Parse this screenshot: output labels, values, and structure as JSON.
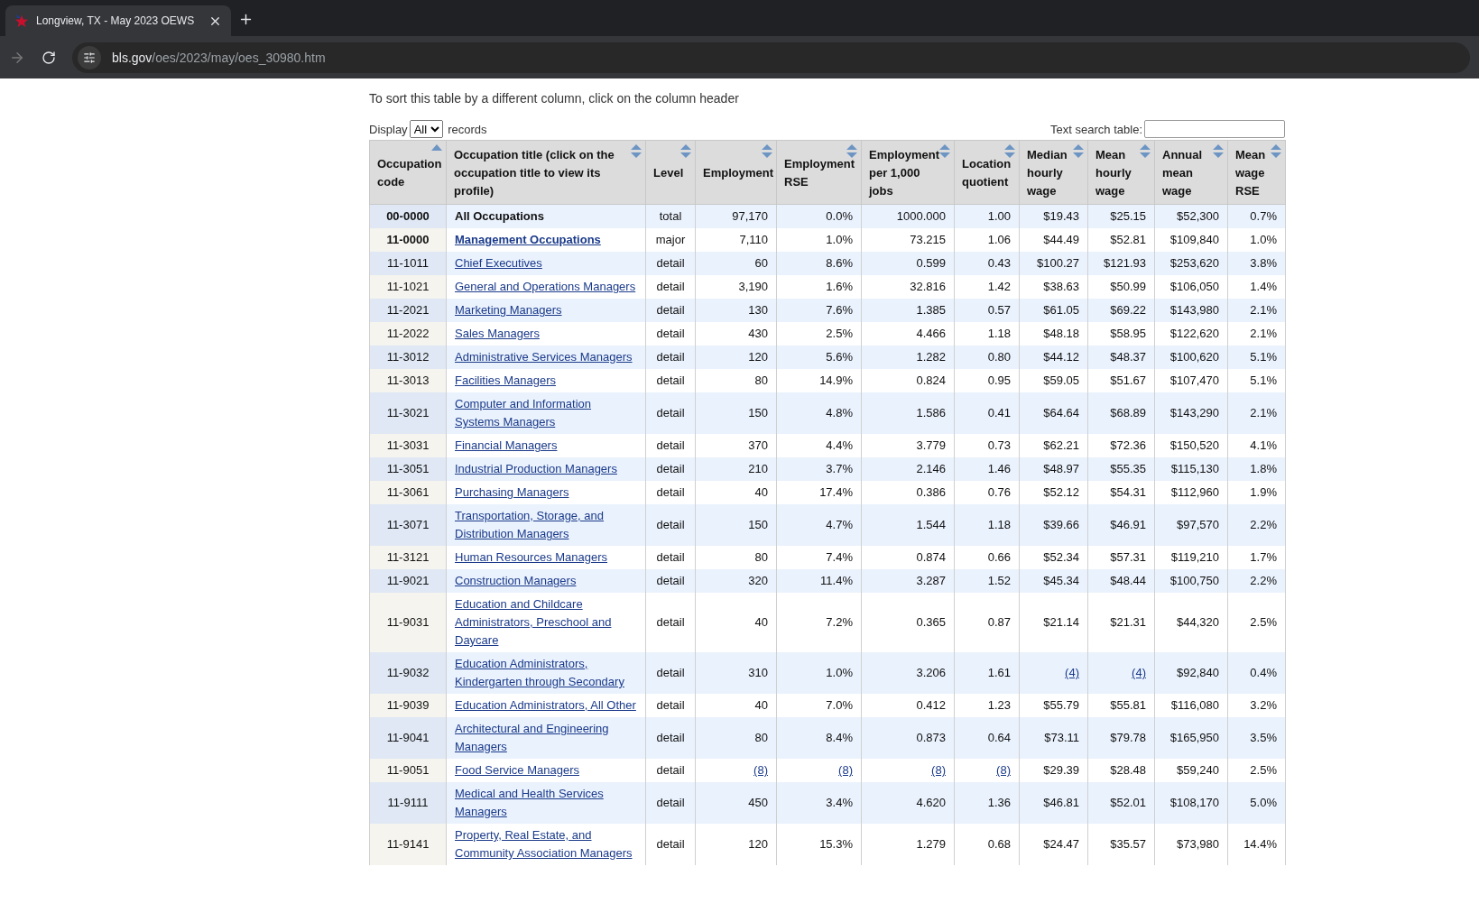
{
  "browser": {
    "tab": {
      "title": "Longview, TX - May 2023 OEWS",
      "selected": true
    },
    "url_host": "bls.gov",
    "url_path": "/oes/2023/may/oes_30980.htm"
  },
  "intro": "To sort this table by a different column, click on the column header",
  "display": {
    "label_before": "Display",
    "value": "All",
    "label_after": "records"
  },
  "search": {
    "label": "Text search table:"
  },
  "table": {
    "columns": [
      {
        "label": "Occupation code",
        "sorted": true
      },
      {
        "label": "Occupation title (click on the occupation title to view its profile)",
        "sorted": false
      },
      {
        "label": "Level",
        "sorted": false
      },
      {
        "label": "Employment",
        "sorted": false
      },
      {
        "label": "Employment RSE",
        "sorted": false
      },
      {
        "label": "Employment per 1,000 jobs",
        "sorted": false
      },
      {
        "label": "Location quotient",
        "sorted": false
      },
      {
        "label": "Median hourly wage",
        "sorted": false
      },
      {
        "label": "Mean hourly wage",
        "sorted": false
      },
      {
        "label": "Annual mean wage",
        "sorted": false
      },
      {
        "label": "Mean wage RSE",
        "sorted": false
      }
    ],
    "rows": [
      {
        "bold": true,
        "title_link": false,
        "cells": [
          "00-0000",
          "All Occupations",
          "total",
          "97,170",
          "0.0%",
          "1000.000",
          "1.00",
          "$19.43",
          "$25.15",
          "$52,300",
          "0.7%"
        ]
      },
      {
        "bold": true,
        "title_link": true,
        "cells": [
          "11-0000",
          "Management Occupations",
          "major",
          "7,110",
          "1.0%",
          "73.215",
          "1.06",
          "$44.49",
          "$52.81",
          "$109,840",
          "1.0%"
        ]
      },
      {
        "bold": false,
        "title_link": true,
        "cells": [
          "11-1011",
          "Chief Executives",
          "detail",
          "60",
          "8.6%",
          "0.599",
          "0.43",
          "$100.27",
          "$121.93",
          "$253,620",
          "3.8%"
        ]
      },
      {
        "bold": false,
        "title_link": true,
        "cells": [
          "11-1021",
          "General and Operations Managers",
          "detail",
          "3,190",
          "1.6%",
          "32.816",
          "1.42",
          "$38.63",
          "$50.99",
          "$106,050",
          "1.4%"
        ]
      },
      {
        "bold": false,
        "title_link": true,
        "cells": [
          "11-2021",
          "Marketing Managers",
          "detail",
          "130",
          "7.6%",
          "1.385",
          "0.57",
          "$61.05",
          "$69.22",
          "$143,980",
          "2.1%"
        ]
      },
      {
        "bold": false,
        "title_link": true,
        "cells": [
          "11-2022",
          "Sales Managers",
          "detail",
          "430",
          "2.5%",
          "4.466",
          "1.18",
          "$48.18",
          "$58.95",
          "$122,620",
          "2.1%"
        ]
      },
      {
        "bold": false,
        "title_link": true,
        "cells": [
          "11-3012",
          "Administrative Services Managers",
          "detail",
          "120",
          "5.6%",
          "1.282",
          "0.80",
          "$44.12",
          "$48.37",
          "$100,620",
          "5.1%"
        ]
      },
      {
        "bold": false,
        "title_link": true,
        "cells": [
          "11-3013",
          "Facilities Managers",
          "detail",
          "80",
          "14.9%",
          "0.824",
          "0.95",
          "$59.05",
          "$51.67",
          "$107,470",
          "5.1%"
        ]
      },
      {
        "bold": false,
        "title_link": true,
        "cells": [
          "11-3021",
          "Computer and Information Systems Managers",
          "detail",
          "150",
          "4.8%",
          "1.586",
          "0.41",
          "$64.64",
          "$68.89",
          "$143,290",
          "2.1%"
        ]
      },
      {
        "bold": false,
        "title_link": true,
        "cells": [
          "11-3031",
          "Financial Managers",
          "detail",
          "370",
          "4.4%",
          "3.779",
          "0.73",
          "$62.21",
          "$72.36",
          "$150,520",
          "4.1%"
        ]
      },
      {
        "bold": false,
        "title_link": true,
        "cells": [
          "11-3051",
          "Industrial Production Managers",
          "detail",
          "210",
          "3.7%",
          "2.146",
          "1.46",
          "$48.97",
          "$55.35",
          "$115,130",
          "1.8%"
        ]
      },
      {
        "bold": false,
        "title_link": true,
        "cells": [
          "11-3061",
          "Purchasing Managers",
          "detail",
          "40",
          "17.4%",
          "0.386",
          "0.76",
          "$52.12",
          "$54.31",
          "$112,960",
          "1.9%"
        ]
      },
      {
        "bold": false,
        "title_link": true,
        "cells": [
          "11-3071",
          "Transportation, Storage, and Distribution Managers",
          "detail",
          "150",
          "4.7%",
          "1.544",
          "1.18",
          "$39.66",
          "$46.91",
          "$97,570",
          "2.2%"
        ]
      },
      {
        "bold": false,
        "title_link": true,
        "cells": [
          "11-3121",
          "Human Resources Managers",
          "detail",
          "80",
          "7.4%",
          "0.874",
          "0.66",
          "$52.34",
          "$57.31",
          "$119,210",
          "1.7%"
        ]
      },
      {
        "bold": false,
        "title_link": true,
        "cells": [
          "11-9021",
          "Construction Managers",
          "detail",
          "320",
          "11.4%",
          "3.287",
          "1.52",
          "$45.34",
          "$48.44",
          "$100,750",
          "2.2%"
        ]
      },
      {
        "bold": false,
        "title_link": true,
        "cells": [
          "11-9031",
          "Education and Childcare Administrators, Preschool and Daycare",
          "detail",
          "40",
          "7.2%",
          "0.365",
          "0.87",
          "$21.14",
          "$21.31",
          "$44,320",
          "2.5%"
        ]
      },
      {
        "bold": false,
        "title_link": true,
        "cells": [
          "11-9032",
          "Education Administrators, Kindergarten through Secondary",
          "detail",
          "310",
          "1.0%",
          "3.206",
          "1.61",
          {
            "text": "(4)",
            "link": true
          },
          {
            "text": "(4)",
            "link": true
          },
          "$92,840",
          "0.4%"
        ]
      },
      {
        "bold": false,
        "title_link": true,
        "cells": [
          "11-9039",
          "Education Administrators, All Other",
          "detail",
          "40",
          "7.0%",
          "0.412",
          "1.23",
          "$55.79",
          "$55.81",
          "$116,080",
          "3.2%"
        ]
      },
      {
        "bold": false,
        "title_link": true,
        "cells": [
          "11-9041",
          "Architectural and Engineering Managers",
          "detail",
          "80",
          "8.4%",
          "0.873",
          "0.64",
          "$73.11",
          "$79.78",
          "$165,950",
          "3.5%"
        ]
      },
      {
        "bold": false,
        "title_link": true,
        "cells": [
          "11-9051",
          "Food Service Managers",
          "detail",
          {
            "text": "(8)",
            "link": true
          },
          {
            "text": "(8)",
            "link": true
          },
          {
            "text": "(8)",
            "link": true
          },
          {
            "text": "(8)",
            "link": true
          },
          "$29.39",
          "$28.48",
          "$59,240",
          "2.5%"
        ]
      },
      {
        "bold": false,
        "title_link": true,
        "cells": [
          "11-9111",
          "Medical and Health Services Managers",
          "detail",
          "450",
          "3.4%",
          "4.620",
          "1.36",
          "$46.81",
          "$52.01",
          "$108,170",
          "5.0%"
        ]
      },
      {
        "bold": false,
        "title_link": true,
        "cells": [
          "11-9141",
          "Property, Real Estate, and Community Association Managers",
          "detail",
          "120",
          "15.3%",
          "1.279",
          "0.68",
          "$24.47",
          "$35.57",
          "$73,980",
          "14.4%"
        ]
      }
    ]
  }
}
